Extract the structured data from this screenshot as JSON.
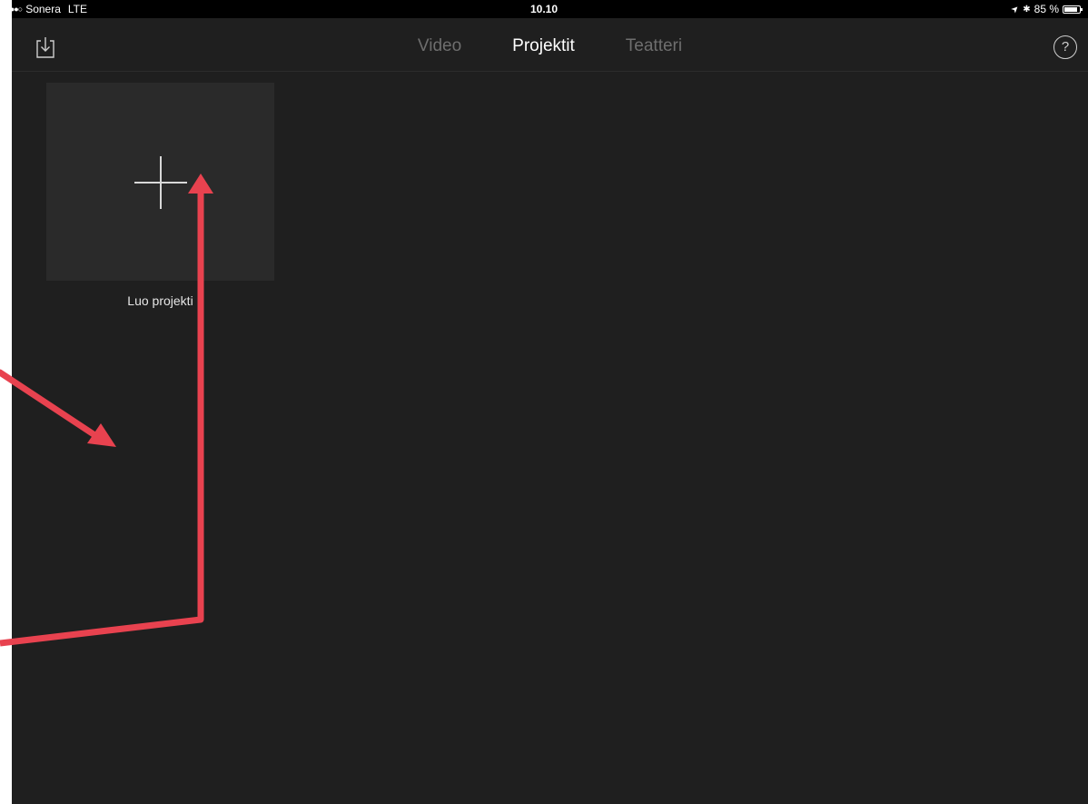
{
  "status_bar": {
    "signal": "●●●●○",
    "carrier": "Sonera",
    "network": "LTE",
    "time": "10.10",
    "location_icon": "➤",
    "bluetooth_icon": "✱",
    "battery_percent": "85 %",
    "battery_level": 0.85
  },
  "nav": {
    "import_icon": "import-icon",
    "tabs": [
      {
        "label": "Video",
        "active": false
      },
      {
        "label": "Projektit",
        "active": true
      },
      {
        "label": "Teatteri",
        "active": false
      }
    ],
    "help_label": "?"
  },
  "content": {
    "new_project_label": "Luo projekti"
  },
  "colors": {
    "background": "#1f1f1f",
    "tile": "#2a2a2a",
    "annotation_arrow": "#e8424f",
    "active_tab": "#ffffff",
    "inactive_tab": "#6e6e6e"
  }
}
